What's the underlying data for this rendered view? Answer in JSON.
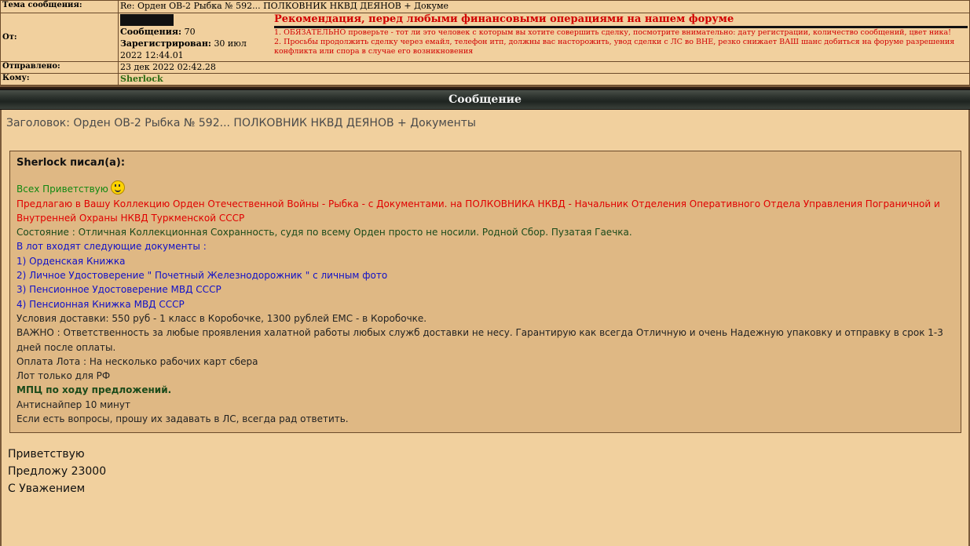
{
  "header": {
    "subject_label": "Тема сообщения:",
    "subject_value": "Re: Орден ОВ-2 Рыбка № 592... ПОЛКОВНИК НКВД ДЕЯНОВ + Докуме",
    "from_label": "От:",
    "posts_label": "Сообщения:",
    "posts_value": "70",
    "registered_label": "Зарегистрирован:",
    "registered_value": "30 июл 2022 12:44.01",
    "sent_label": "Отправлено:",
    "sent_value": "23 дек 2022 02:42.28",
    "to_label": "Кому:",
    "to_value": "Sherlock"
  },
  "recommendation": {
    "title": "Рекомендация, перед любыми финансовыми операциями на нашем форуме",
    "item1": "1. ОБЯЗАТЕЛЬНО проверьте - тот ли это человек с которым вы хотите совершить сделку, посмотрите внимательно: дату регистрации, количество сообщений, цвет ника!",
    "item2": "2. Просьбы продолжить сделку через емайл, телефон итп, должны вас насторожить, увод сделки с ЛС во ВНЕ, резко снижает ВАШ шанс добиться на форуме разрешения конфликта или спора в случае его возникновения"
  },
  "banner": "Сообщение",
  "message": {
    "topic": "Заголовок: Орден ОВ-2 Рыбка № 592... ПОЛКОВНИК НКВД ДЕЯНОВ + Документы",
    "quote_author": "Sherlock писал(а):",
    "greeting": "Всех Приветствую",
    "offer": "Предлагаю в Вашу Коллекцию Орден Отечественной Войны - Рыбка - с Документами. на ПОЛКОВНИКА НКВД - Начальник Отделения Оперативного Отдела Управления Пограничной и Внутренней Охраны НКВД Туркменской СССР",
    "condition": "Состояние : Отличная Коллекционная Сохранность, судя по всему Орден просто не носили. Родной Сбор. Пузатая Гаечка.",
    "docs_intro": "В лот входят следующие документы :",
    "doc1": "1) Орденская Книжка",
    "doc2": "2) Личное Удостоверение \" Почетный Железнодорожник \" с личным фото",
    "doc3": "3) Пенсионное Удостоверение МВД СССР",
    "doc4": "4) Пенсионная Книжка МВД СССР",
    "delivery": "Условия доставки: 550 руб - 1 класс в Коробочке, 1300 рублей EMC - в Коробочке.",
    "important": "ВАЖНО : Ответственность за любые проявления халатной работы любых служб доставки не несу. Гарантирую как всегда Отличную и очень Надежную упаковку и отправку в срок 1-3 дней после оплаты.",
    "payment": "Оплата Лота : На несколько рабочих карт сбера",
    "rf_only": "Лот только для РФ",
    "mpc": "МПЦ по ходу предложений.",
    "antisniper": "Антиснайпер 10 минут",
    "questions": "Если есть вопросы, прошу их задавать в ЛС, всегда рад ответить.",
    "reply1": "Приветствую",
    "reply2": "Предложу 23000",
    "reply3": "С Уважением"
  }
}
